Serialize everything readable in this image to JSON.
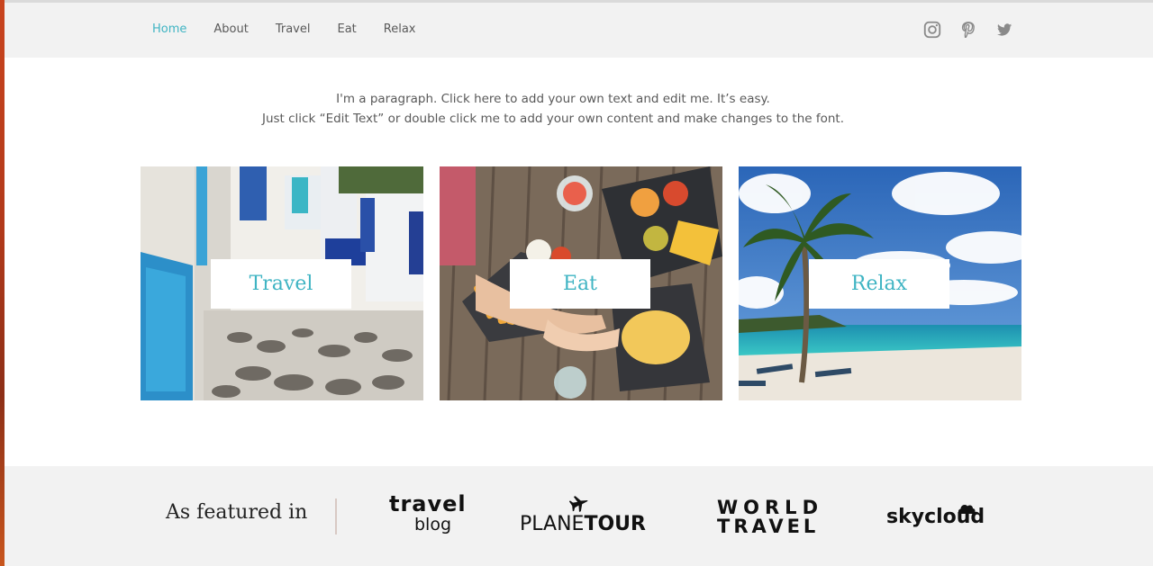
{
  "nav": {
    "items": [
      {
        "label": "Home",
        "active": true
      },
      {
        "label": "About"
      },
      {
        "label": "Travel"
      },
      {
        "label": "Eat"
      },
      {
        "label": "Relax"
      }
    ],
    "accent_color": "#3fb4c3"
  },
  "social": [
    "instagram-icon",
    "pinterest-icon",
    "twitter-icon"
  ],
  "intro": {
    "line1": "I'm a paragraph. Click here to add your own text and edit me. It’s easy.",
    "line2": "Just click “Edit Text” or double click me to add your own content and make changes to the font."
  },
  "cards": [
    {
      "label": "Travel"
    },
    {
      "label": "Eat"
    },
    {
      "label": "Relax"
    }
  ],
  "featured": {
    "title": "As featured in",
    "logos": {
      "travelblog": {
        "line1": "travel",
        "line2": "blog"
      },
      "planetour": {
        "light": "PLANE",
        "bold": "TOUR"
      },
      "worldtravel": {
        "line1": "WORLD",
        "line2": "TRAVEL"
      },
      "skycloud": {
        "text": "skycloud"
      }
    }
  }
}
